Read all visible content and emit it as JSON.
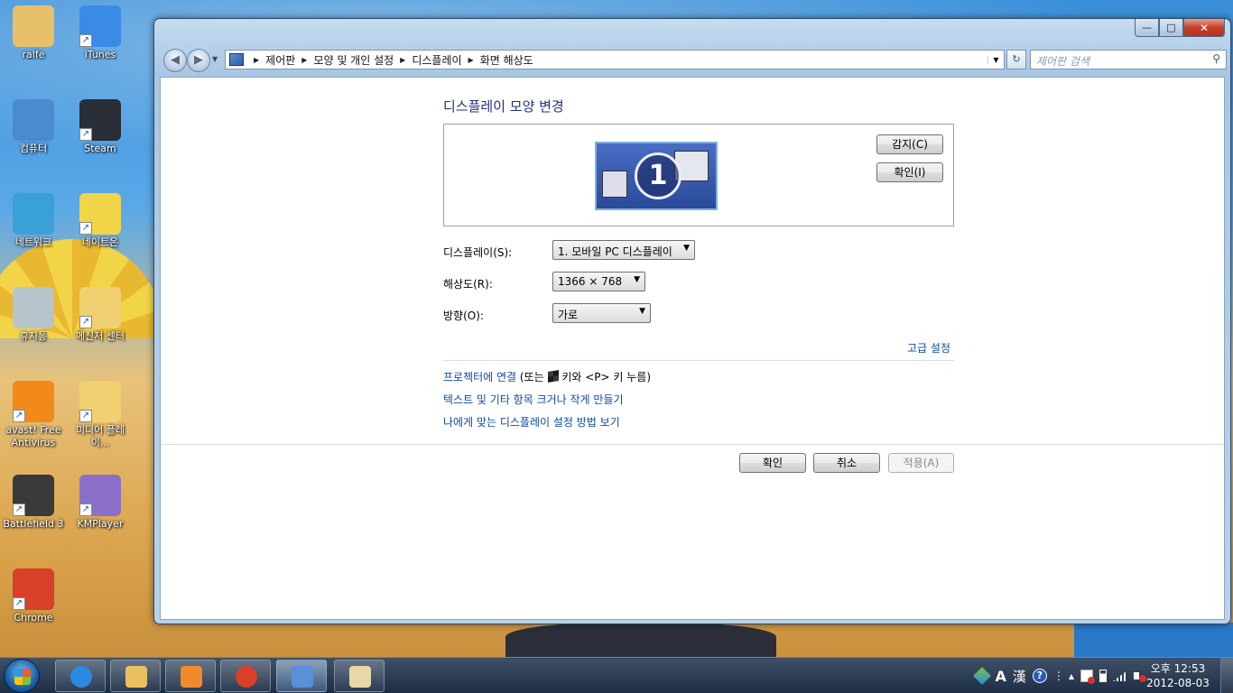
{
  "desktop": {
    "icons": [
      {
        "label": "ralfe",
        "icon": "user-folder-icon",
        "color": "#e8c06a"
      },
      {
        "label": "iTunes",
        "icon": "itunes-icon",
        "color": "#3a8ae8"
      },
      {
        "label": "컴퓨터",
        "icon": "computer-icon",
        "color": "#4a8ad0"
      },
      {
        "label": "Steam",
        "icon": "steam-icon",
        "color": "#2a2e36"
      },
      {
        "label": "네트워크",
        "icon": "network-icon",
        "color": "#3aa0d8"
      },
      {
        "label": "네이트온",
        "icon": "nateon-icon",
        "color": "#f2d448"
      },
      {
        "label": "휴지통",
        "icon": "recycle-bin-icon",
        "color": "#b8c4cc"
      },
      {
        "label": "메신저 센터",
        "icon": "messenger-folder-icon",
        "color": "#f0d070"
      },
      {
        "label": "avast! Free Antivirus",
        "icon": "avast-icon",
        "color": "#f28a1a"
      },
      {
        "label": "미디어 플레이...",
        "icon": "media-player-folder-icon",
        "color": "#f0d070"
      },
      {
        "label": "Battlefield 3",
        "icon": "battlefield-icon",
        "color": "#3a3a3a"
      },
      {
        "label": "KMPlayer",
        "icon": "kmplayer-icon",
        "color": "#8a70c8"
      },
      {
        "label": "Chrome",
        "icon": "chrome-icon",
        "color": "#d8402a"
      }
    ]
  },
  "window": {
    "controls": {
      "minimize": "—",
      "maximize": "□",
      "close": "✕"
    },
    "nav": {
      "back": "◀",
      "forward": "▶",
      "dropdown": "▼"
    },
    "breadcrumb": [
      "제어판",
      "모양 및 개인 설정",
      "디스플레이",
      "화면 해상도"
    ],
    "breadcrumb_sep": "▶",
    "address_dropdown": "▼",
    "refresh": "↻",
    "search_placeholder": "제어판 검색",
    "search_icon": "⚲"
  },
  "page": {
    "title": "디스플레이 모양 변경",
    "monitor_number": "1",
    "detect_button": "감지(C)",
    "identify_button": "확인(I)",
    "display_label": "디스플레이(S):",
    "display_value": "1. 모바일 PC 디스플레이",
    "resolution_label": "해상도(R):",
    "resolution_value": "1366 × 768",
    "orientation_label": "방향(O):",
    "orientation_value": "가로",
    "caret": "▼",
    "advanced_link": "고급 설정",
    "projector_link": "프로젝터에 연결",
    "projector_hint_pre": " (또는 ",
    "projector_hint_post": " 키와 <P> 키 누름)",
    "text_size_link": "텍스트 및 기타 항목 크거나 작게 만들기",
    "which_settings_link": "나에게 맞는 디스플레이 설정 방법 보기",
    "ok_button": "확인",
    "cancel_button": "취소",
    "apply_button": "적용(A)"
  },
  "taskbar": {
    "pinned": [
      {
        "name": "internet-explorer-icon",
        "color": "#2a8ae0"
      },
      {
        "name": "explorer-folder-icon",
        "color": "#e8c060"
      },
      {
        "name": "media-player-icon",
        "color": "#f08a2a"
      },
      {
        "name": "chrome-icon",
        "color": "#d8402a"
      },
      {
        "name": "control-panel-icon",
        "color": "#5a90d8"
      },
      {
        "name": "paint-icon",
        "color": "#e8d8a8"
      }
    ],
    "tray": {
      "ime_a": "A",
      "ime_han": "漢",
      "help": "?",
      "arrow_up": "▲"
    },
    "clock_time": "오후 12:53",
    "clock_date": "2012-08-03"
  }
}
